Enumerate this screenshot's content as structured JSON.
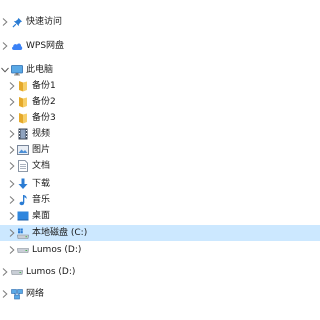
{
  "nav": {
    "quick_access": {
      "label": "快速访问",
      "icon": "pin-icon",
      "color": "#2b7cd3"
    },
    "wps_cloud": {
      "label": "WPS网盘",
      "icon": "cloud-icon",
      "color": "#3b82f6"
    },
    "this_pc": {
      "label": "此电脑",
      "icon": "computer-icon",
      "expanded": true,
      "children": [
        {
          "label": "备份1",
          "icon": "folder-icon"
        },
        {
          "label": "备份2",
          "icon": "folder-icon"
        },
        {
          "label": "备份3",
          "icon": "folder-icon"
        },
        {
          "label": "视频",
          "icon": "video-icon"
        },
        {
          "label": "图片",
          "icon": "picture-icon"
        },
        {
          "label": "文档",
          "icon": "document-icon"
        },
        {
          "label": "下载",
          "icon": "download-icon"
        },
        {
          "label": "音乐",
          "icon": "music-icon"
        },
        {
          "label": "桌面",
          "icon": "desktop-icon"
        },
        {
          "label": "本地磁盘 (C:)",
          "icon": "windows-drive-icon",
          "selected": true
        },
        {
          "label": "Lumos (D:)",
          "icon": "drive-icon"
        }
      ]
    },
    "lumos_drive": {
      "label": "Lumos (D:)",
      "icon": "drive-icon"
    },
    "network": {
      "label": "网络",
      "icon": "network-icon"
    }
  },
  "colors": {
    "selection": "#cce8ff",
    "folder": "#f2c14e",
    "accent_blue": "#2b7cd3",
    "chevron": "#7a7a7a"
  }
}
